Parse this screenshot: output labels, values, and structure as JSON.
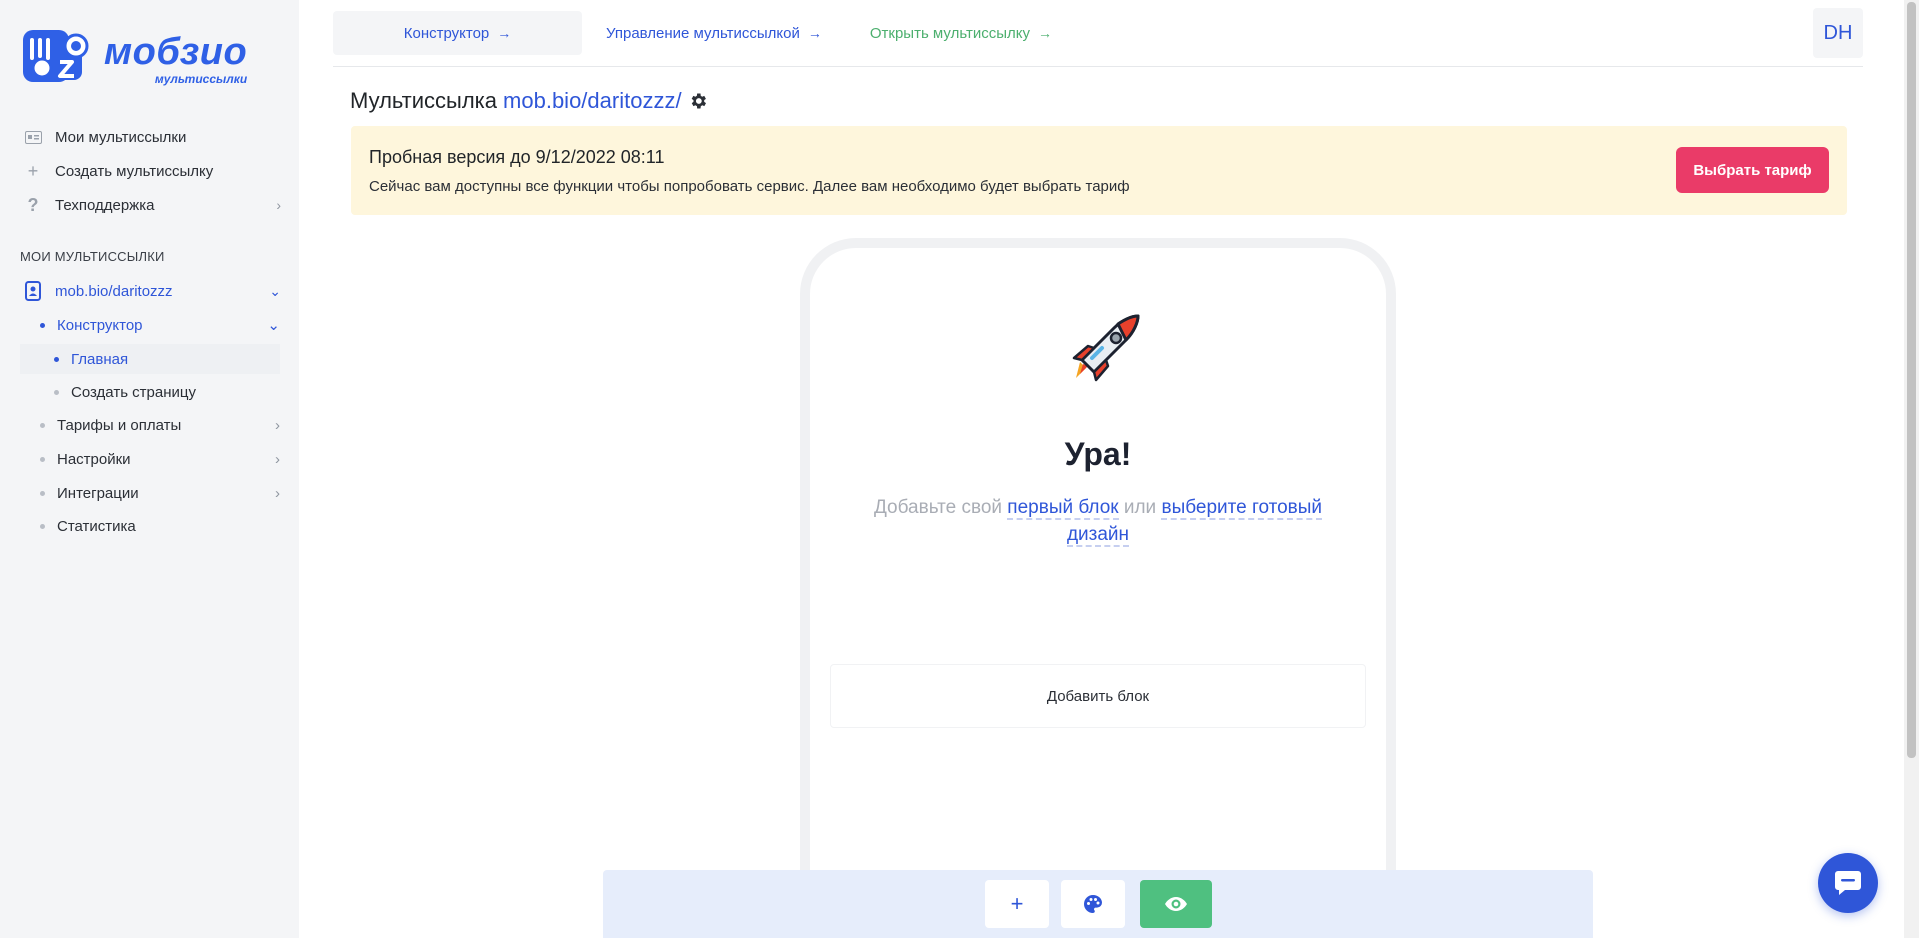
{
  "brand": {
    "title": "мобзио",
    "subtitle": "мультиссылки",
    "color": "#2f60e6"
  },
  "sidebar": {
    "top_items": [
      {
        "label": "Мои мультиссылки",
        "icon": "id-card-icon"
      },
      {
        "label": "Создать мультиссылку",
        "icon": "plus-icon"
      },
      {
        "label": "Техподдержка",
        "icon": "question-icon"
      }
    ],
    "section_title": "МОИ МУЛЬТИССЫЛКИ",
    "link_item": "mob.bio/daritozzz",
    "constructor": "Конструктор",
    "pages": [
      "Главная",
      "Создать страницу"
    ],
    "others": [
      "Тарифы и оплаты",
      "Настройки",
      "Интеграции",
      "Статистика"
    ]
  },
  "topbar": {
    "tabs": [
      "Конструктор",
      "Управление мультиссылкой",
      "Открыть мультиссылку"
    ],
    "avatar": "DH"
  },
  "heading": {
    "prefix": "Мультиссылка",
    "link": "mob.bio/daritozzz/"
  },
  "banner": {
    "title": "Пробная версия до 9/12/2022 08:11",
    "text": "Сейчас вам доступны все функции чтобы попробовать сервис. Далее вам необходимо будет выбрать тариф",
    "button": "Выбрать тариф",
    "button_color": "#ea3b68"
  },
  "phone": {
    "title": "Ура!",
    "hint_start": "Добавьте свой",
    "hint_link1": "первый блок",
    "hint_mid": "или",
    "hint_link2": "выберите готовый дизайн",
    "add_block": "Добавить блок"
  },
  "toolbar": {
    "plus": "+",
    "icons": [
      "plus-icon",
      "palette-icon",
      "eye-icon"
    ]
  }
}
